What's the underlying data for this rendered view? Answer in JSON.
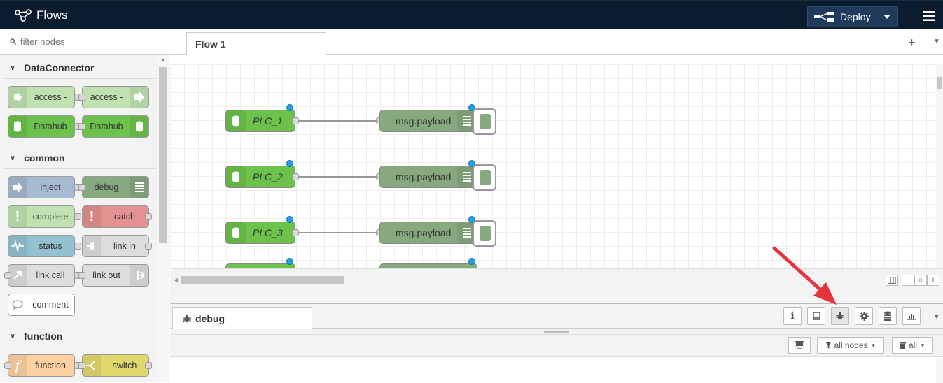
{
  "header": {
    "app_title": "Flows",
    "deploy_label": "Deploy"
  },
  "palette": {
    "search_placeholder": "filter nodes",
    "categories": [
      {
        "label": "DataConnector"
      },
      {
        "label": "common"
      },
      {
        "label": "function"
      }
    ],
    "nodes": {
      "access_1": "access -",
      "access_2": "access -",
      "datahub_1": "Datahub",
      "datahub_2": "Datahub",
      "inject": "inject",
      "debug": "debug",
      "complete": "complete",
      "catch": "catch",
      "status": "status",
      "link_in": "link in",
      "link_call": "link call",
      "link_out": "link out",
      "comment": "comment",
      "function": "function",
      "switch": "switch"
    }
  },
  "workspace": {
    "tabs": [
      {
        "label": "Flow 1"
      }
    ],
    "flow_nodes": [
      {
        "input": "PLC_1",
        "output": "msg.payload"
      },
      {
        "input": "PLC_2",
        "output": "msg.payload"
      },
      {
        "input": "PLC_3",
        "output": "msg.payload"
      }
    ]
  },
  "sidebar": {
    "active_tab": "debug",
    "filter_label": "all nodes",
    "clear_label": "all"
  },
  "colors": {
    "header_bg": "#0b1c2e",
    "datahub_green": "#6cc24a",
    "debug_green": "#87a980",
    "inject_blue": "#a6bbcf",
    "catch_red": "#e49191",
    "status_blue": "#94c1d0",
    "function_orange": "#fdd0a2",
    "switch_yellow": "#e2d96e",
    "access_green": "#bfe2b0",
    "annotation_red": "#e8333a"
  },
  "icons": [
    "flows-logo-icon",
    "deploy-icon",
    "menu-icon",
    "search-icon",
    "database-icon",
    "list-icon",
    "bug-icon",
    "info-icon",
    "book-icon",
    "gear-icon",
    "chart-icon"
  ]
}
